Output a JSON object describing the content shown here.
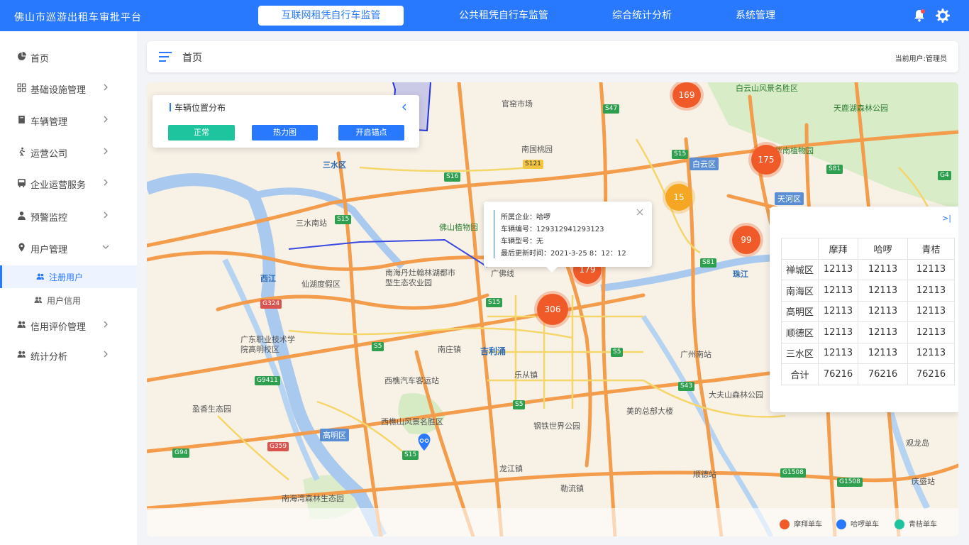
{
  "app": {
    "title": "佛山市巡游出租车审批平台"
  },
  "nav": {
    "tabs": [
      {
        "label": "互联网租凭自行车监管"
      },
      {
        "label": "公共租凭自行车监管"
      },
      {
        "label": "综合统计分析"
      },
      {
        "label": "系统管理"
      }
    ]
  },
  "sidebar": {
    "items": [
      {
        "label": "首页",
        "icon": "pie-chart-icon"
      },
      {
        "label": "基础设施管理",
        "icon": "grid-icon"
      },
      {
        "label": "车辆管理",
        "icon": "book-icon"
      },
      {
        "label": "运营公司",
        "icon": "walker-icon"
      },
      {
        "label": "企业运营服务",
        "icon": "bus-icon"
      },
      {
        "label": "预警监控",
        "icon": "user-icon"
      },
      {
        "label": "用户管理",
        "icon": "location-pin-icon"
      },
      {
        "label": "信用评价管理",
        "icon": "group-icon"
      },
      {
        "label": "统计分析",
        "icon": "group-icon"
      }
    ],
    "subitems": [
      {
        "label": "注册用户"
      },
      {
        "label": "用户信用"
      }
    ]
  },
  "header": {
    "title": "首页",
    "current_user": "当前用户:管理员"
  },
  "distribution_panel": {
    "title": "车辆位置分布",
    "buttons": [
      {
        "label": "正常",
        "color": "#1ec49d"
      },
      {
        "label": "热力图",
        "color": "#2979ff"
      },
      {
        "label": "开启锚点",
        "color": "#2979ff"
      }
    ]
  },
  "popup": {
    "company": "所属企业：哈啰",
    "vehicle_no": "车辆编号：129312941293123",
    "vehicle_type": "车辆型号：无",
    "updated": "最后更新时间：2021-3-25  8：12：12"
  },
  "clusters": [
    {
      "count": "169",
      "color": "#f05a28"
    },
    {
      "count": "175",
      "color": "#f05a28"
    },
    {
      "count": "15",
      "color": "#f5a623"
    },
    {
      "count": "99",
      "color": "#f05a28"
    },
    {
      "count": "179",
      "color": "#f05a28"
    },
    {
      "count": "306",
      "color": "#f05a28"
    }
  ],
  "map_labels": {
    "sanshui": "三水区",
    "baiyun": "白云区",
    "tianhe": "天河区",
    "gaoming": "高明区",
    "jilichong": "吉利涌",
    "foshan_botanic": "佛山植物园",
    "baiyunshan": "白云山风景名胜区",
    "south_botanic": "华南植物园",
    "tianlu": "天鹿湖森林公园",
    "nanguo": "南国桃园",
    "guanghai": "官窑市场",
    "sanshui_south": "三水南站",
    "xianhu": "仙湖度假区",
    "nanhai_park": "南海丹灶翰林湖都市型生态农业园",
    "guangdong_college": "广东职业技术学院高明校区",
    "xiqiao_bus": "西樵汽车客运站",
    "xiqiao_mtn": "西樵山风景名胜区",
    "steel_park": "钢铁世界公园",
    "meide": "美的总部大楼",
    "guangzhou_south": "广州南站",
    "dafu": "大夫山森林公园",
    "shunde": "顺德站",
    "yingxiang": "盈香生态园",
    "nanhai_forest": "南海湾森林生态园",
    "qingsheng": "庆盛站",
    "guanlong": "观龙岛",
    "nanzhuang": "南庄镇",
    "lecong": "乐从镇",
    "longjiang": "龙江镇",
    "leliu": "勒流镇",
    "zhujiang": "珠江",
    "guangxi": "西江",
    "guangfo": "广佛线"
  },
  "road_tags": {
    "s47": "S47",
    "s16": "S16",
    "s15a": "S15",
    "s15b": "S15",
    "s121": "S121",
    "g324": "G324",
    "s5a": "S5",
    "s5b": "S5",
    "g9411": "G9411",
    "g359": "G359",
    "g94": "G94",
    "s15c": "S15",
    "s43": "S43",
    "s81": "S81",
    "g4": "G4",
    "g1508a": "G1508",
    "g1508b": "G1508",
    "s81b": "S81",
    "s15d": "S15",
    "s5c": "S5"
  },
  "stats": {
    "close_label": ">|",
    "columns": [
      "摩拜",
      "哈啰",
      "青桔"
    ],
    "rows": [
      {
        "district": "禅城区",
        "values": [
          "12113",
          "12113",
          "12113"
        ]
      },
      {
        "district": "南海区",
        "values": [
          "12113",
          "12113",
          "12113"
        ]
      },
      {
        "district": "高明区",
        "values": [
          "12113",
          "12113",
          "12113"
        ]
      },
      {
        "district": "顺德区",
        "values": [
          "12113",
          "12113",
          "12113"
        ]
      },
      {
        "district": "三水区",
        "values": [
          "12113",
          "12113",
          "12113"
        ]
      },
      {
        "district": "合计",
        "values": [
          "76216",
          "76216",
          "76216"
        ]
      }
    ]
  },
  "legend": {
    "items": [
      {
        "label": "摩拜单车",
        "color": "#f05a28"
      },
      {
        "label": "哈啰单车",
        "color": "#2979ff"
      },
      {
        "label": "青桔单车",
        "color": "#1ec49d"
      }
    ]
  }
}
